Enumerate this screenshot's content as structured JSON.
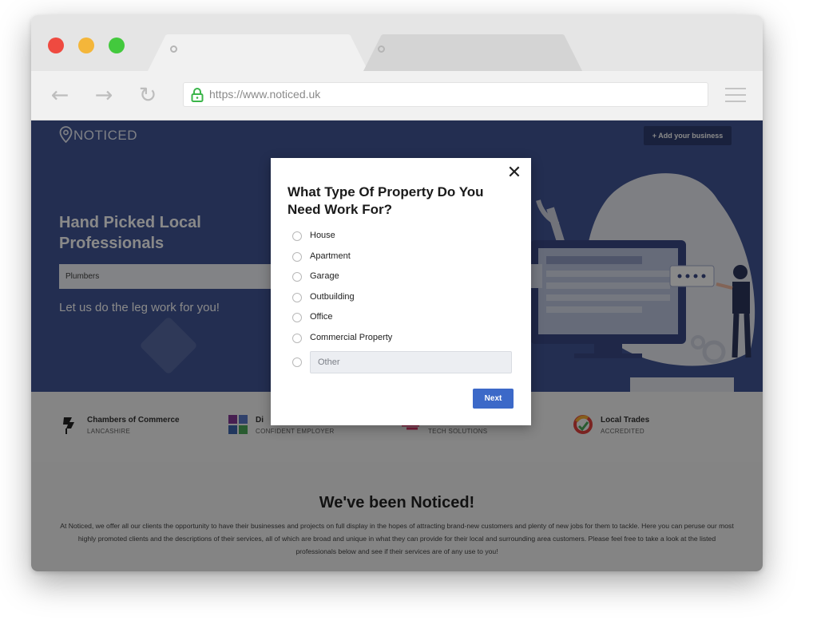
{
  "browser": {
    "url": "https://www.noticed.uk",
    "tabs": [
      {
        "label": ""
      },
      {
        "label": ""
      }
    ]
  },
  "site": {
    "logo_text": "NOTICED",
    "add_business_label": "+ Add your business",
    "hero_title": "Hand Picked Local Professionals",
    "search_value": "Plumbers",
    "hero_subtitle": "Let us do the leg work for you!"
  },
  "trust": [
    {
      "name": "Chambers of Commerce",
      "sub": "LANCASHIRE"
    },
    {
      "name": "Di",
      "sub": "CONFIDENT EMPLOYER"
    },
    {
      "name": "",
      "sub": "TECH SOLUTIONS"
    },
    {
      "name": "Local Trades",
      "sub": "ACCREDITED"
    }
  ],
  "about": {
    "heading": "We've been Noticed!",
    "body": "At Noticed, we offer all our clients the opportunity to have their businesses and projects on full display in the hopes of attracting brand-new customers and plenty of new jobs for them to tackle. Here you can peruse our most highly promoted clients and the descriptions of their services, all of which are broad and unique in what they can provide for their local and surrounding area customers. Please feel free to take a look at the listed professionals below and see if their services are of any use to you!"
  },
  "modal": {
    "title": "What Type Of Property Do You Need Work For?",
    "close_glyph": "✕",
    "options": [
      {
        "label": "House"
      },
      {
        "label": "Apartment"
      },
      {
        "label": "Garage"
      },
      {
        "label": "Outbuilding"
      },
      {
        "label": "Office"
      },
      {
        "label": "Commercial Property"
      }
    ],
    "other_placeholder": "Other",
    "next_label": "Next"
  },
  "colors": {
    "hero_bg": "#33498f",
    "primary_button": "#3c69c8",
    "lock_green": "#3bb54a"
  }
}
